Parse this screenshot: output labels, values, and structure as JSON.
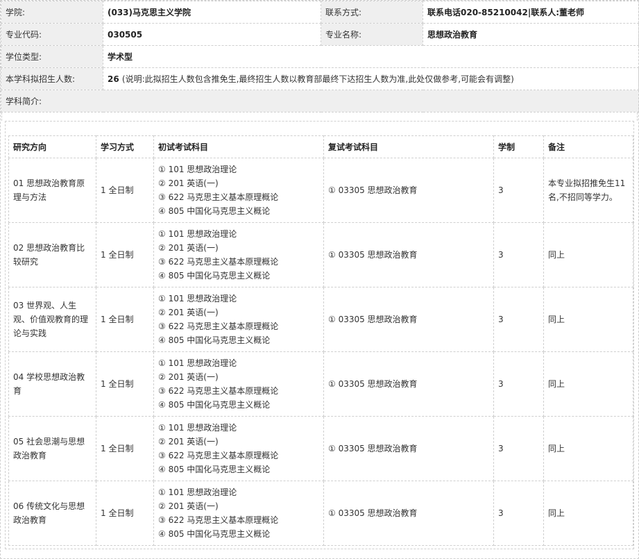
{
  "info": {
    "college_label": "学院:",
    "college_value": "(033)马克思主义学院",
    "contact_label": "联系方式:",
    "contact_value": "联系电话020-85210042|联系人:董老师",
    "major_code_label": "专业代码:",
    "major_code_value": "030505",
    "major_name_label": "专业名称:",
    "major_name_value": "思想政治教育",
    "degree_label": "学位类型:",
    "degree_value": "学术型",
    "quota_label": "本学科拟招生人数:",
    "quota_value": "26",
    "quota_note": "(说明:此拟招生人数包含推免生,最终招生人数以教育部最终下达招生人数为准,此处仅做参考,可能会有调整)",
    "intro_label": "学科简介:"
  },
  "table": {
    "headers": [
      "研究方向",
      "学习方式",
      "初试考试科目",
      "复试考试科目",
      "学制",
      "备注"
    ],
    "rows": [
      {
        "direction": "01 思想政治教育原理与方法",
        "mode": "1 全日制",
        "exam": [
          "①  101  思想政治理论",
          "②  201  英语(一)",
          "③  622  马克思主义基本原理概论",
          "④  805  中国化马克思主义概论"
        ],
        "retest": "①  03305  思想政治教育",
        "years": "3",
        "note": "本专业拟招推免生11名,不招同等学力。"
      },
      {
        "direction": "02 思想政治教育比较研究",
        "mode": "1 全日制",
        "exam": [
          "①  101  思想政治理论",
          "②  201  英语(一)",
          "③  622  马克思主义基本原理概论",
          "④  805  中国化马克思主义概论"
        ],
        "retest": "①  03305  思想政治教育",
        "years": "3",
        "note": "同上"
      },
      {
        "direction": "03 世界观、人生观、价值观教育的理论与实践",
        "mode": "1 全日制",
        "exam": [
          "①  101  思想政治理论",
          "②  201  英语(一)",
          "③  622  马克思主义基本原理概论",
          "④  805  中国化马克思主义概论"
        ],
        "retest": "①  03305  思想政治教育",
        "years": "3",
        "note": "同上"
      },
      {
        "direction": "04 学校思想政治教育",
        "mode": "1 全日制",
        "exam": [
          "①  101  思想政治理论",
          "②  201  英语(一)",
          "③  622  马克思主义基本原理概论",
          "④  805  中国化马克思主义概论"
        ],
        "retest": "①  03305  思想政治教育",
        "years": "3",
        "note": "同上"
      },
      {
        "direction": "05 社会思潮与思想政治教育",
        "mode": "1 全日制",
        "exam": [
          "①  101  思想政治理论",
          "②  201  英语(一)",
          "③  622  马克思主义基本原理概论",
          "④  805  中国化马克思主义概论"
        ],
        "retest": "①  03305  思想政治教育",
        "years": "3",
        "note": "同上"
      },
      {
        "direction": "06 传统文化与思想政治教育",
        "mode": "1 全日制",
        "exam": [
          "①  101  思想政治理论",
          "②  201  英语(一)",
          "③  622  马克思主义基本原理概论",
          "④  805  中国化马克思主义概论"
        ],
        "retest": "①  03305  思想政治教育",
        "years": "3",
        "note": "同上"
      }
    ]
  }
}
